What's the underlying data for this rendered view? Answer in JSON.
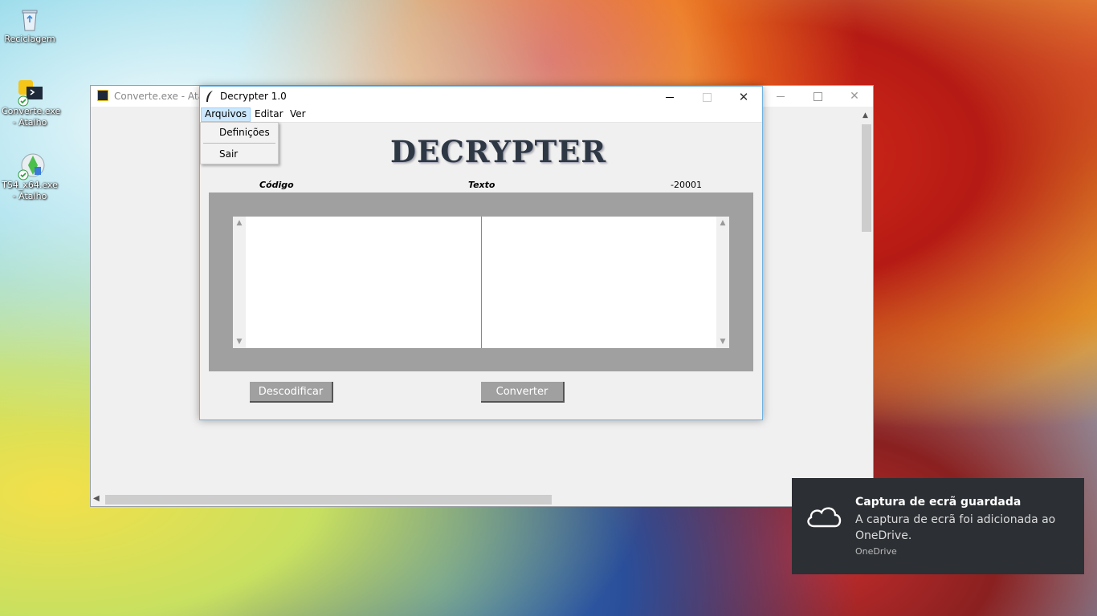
{
  "desktop": {
    "icons": [
      {
        "label": "Reciclagem"
      },
      {
        "label": "Converte.exe - Atalho"
      },
      {
        "label": "TS4_x64.exe - Atalho"
      }
    ]
  },
  "back_window": {
    "title": "Converte.exe - Atalho"
  },
  "main_window": {
    "title": "Decrypter 1.0",
    "menu": [
      "Arquivos",
      "Editar",
      "Ver"
    ],
    "logo": "DECRYPTER",
    "labels": {
      "codigo": "Código",
      "texto": "Texto",
      "counter": "-20001"
    },
    "left_text": "",
    "right_text": "",
    "buttons": {
      "decode": "Descodificar",
      "convert": "Converter"
    }
  },
  "dropdown": {
    "items": [
      "Definições",
      "Sair"
    ]
  },
  "toast": {
    "title": "Captura de ecrã guardada",
    "message": "A captura de ecrã foi adicionada ao OneDrive.",
    "source": "OneDrive"
  },
  "colors": {
    "panel": "#a0a0a0",
    "toast_bg": "#2c2f33",
    "window_border": "#6fb2e0"
  }
}
